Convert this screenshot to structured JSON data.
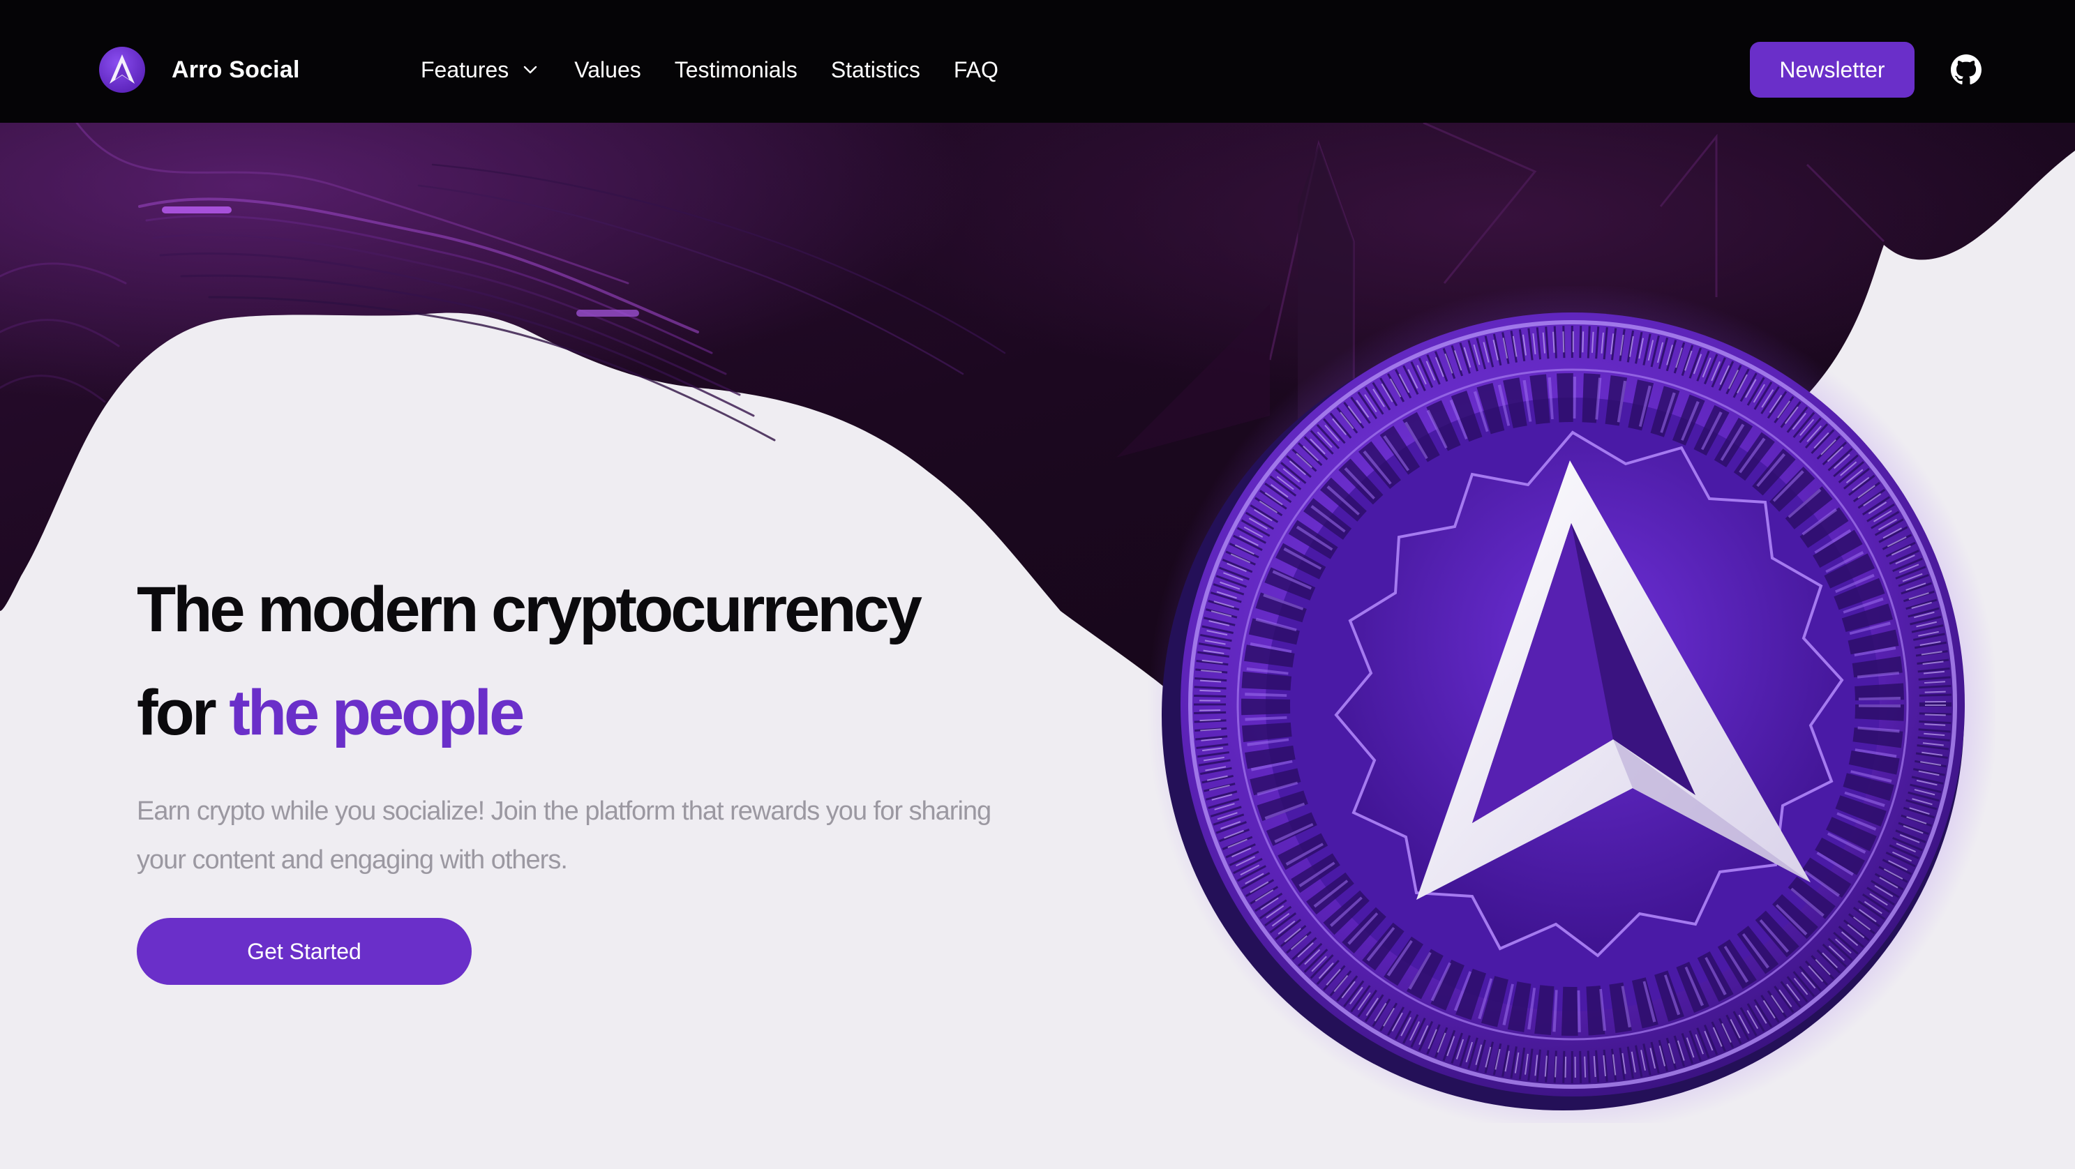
{
  "brand": {
    "name": "Arro Social"
  },
  "nav": {
    "items": [
      {
        "label": "Features",
        "has_dropdown": true
      },
      {
        "label": "Values"
      },
      {
        "label": "Testimonials"
      },
      {
        "label": "Statistics"
      },
      {
        "label": "FAQ"
      }
    ],
    "newsletter_label": "Newsletter",
    "icons": [
      "chevron-down-icon",
      "github-icon"
    ]
  },
  "hero": {
    "headline_line1": "The modern cryptocurrency",
    "headline_line2_prefix": "for ",
    "headline_line2_accent": "the people",
    "subtext": "Earn crypto while you socialize! Join the platform that rewards you for sharing your content and engaging with others.",
    "cta_label": "Get Started"
  },
  "colors": {
    "accent": "#6a2fc9",
    "nav_background": "#050406",
    "page_background": "#efedf2",
    "headline": "#0b0a0d",
    "subtext": "#9b98a1"
  }
}
